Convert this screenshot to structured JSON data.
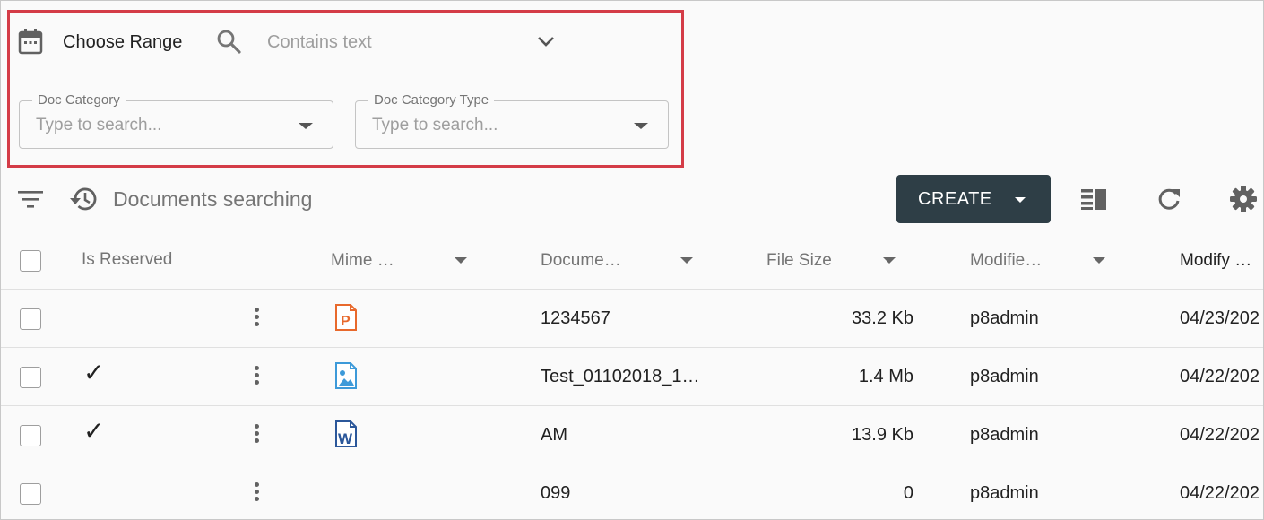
{
  "filters": {
    "range_label": "Choose Range",
    "search_placeholder": "Contains text",
    "doc_category": {
      "label": "Doc Category",
      "placeholder": "Type to search..."
    },
    "doc_category_type": {
      "label": "Doc Category Type",
      "placeholder": "Type to search..."
    }
  },
  "toolbar": {
    "title": "Documents searching",
    "create_label": "CREATE"
  },
  "table": {
    "columns": [
      "Is Reserved",
      "Mime …",
      "Docume…",
      "File Size",
      "Modifie…",
      "Modify …"
    ],
    "rows": [
      {
        "reserved": "",
        "mime_icon": "powerpoint-file-icon",
        "document": "1234567",
        "size": "33.2 Kb",
        "modifier": "p8admin",
        "modify_date": "04/23/202"
      },
      {
        "reserved": "✓",
        "mime_icon": "image-file-icon",
        "document": "Test_01102018_1…",
        "size": "1.4 Mb",
        "modifier": "p8admin",
        "modify_date": "04/22/202"
      },
      {
        "reserved": "✓",
        "mime_icon": "word-file-icon",
        "document": "AM",
        "size": "13.9 Kb",
        "modifier": "p8admin",
        "modify_date": "04/22/202"
      },
      {
        "reserved": "",
        "mime_icon": "",
        "document": "099",
        "size": "0",
        "modifier": "p8admin",
        "modify_date": "04/22/202"
      }
    ]
  },
  "colors": {
    "highlight": "#d43c47",
    "create_bg": "#2e3e46",
    "ppt": "#e8692c",
    "img": "#3d9ad9",
    "word": "#2b579a"
  }
}
